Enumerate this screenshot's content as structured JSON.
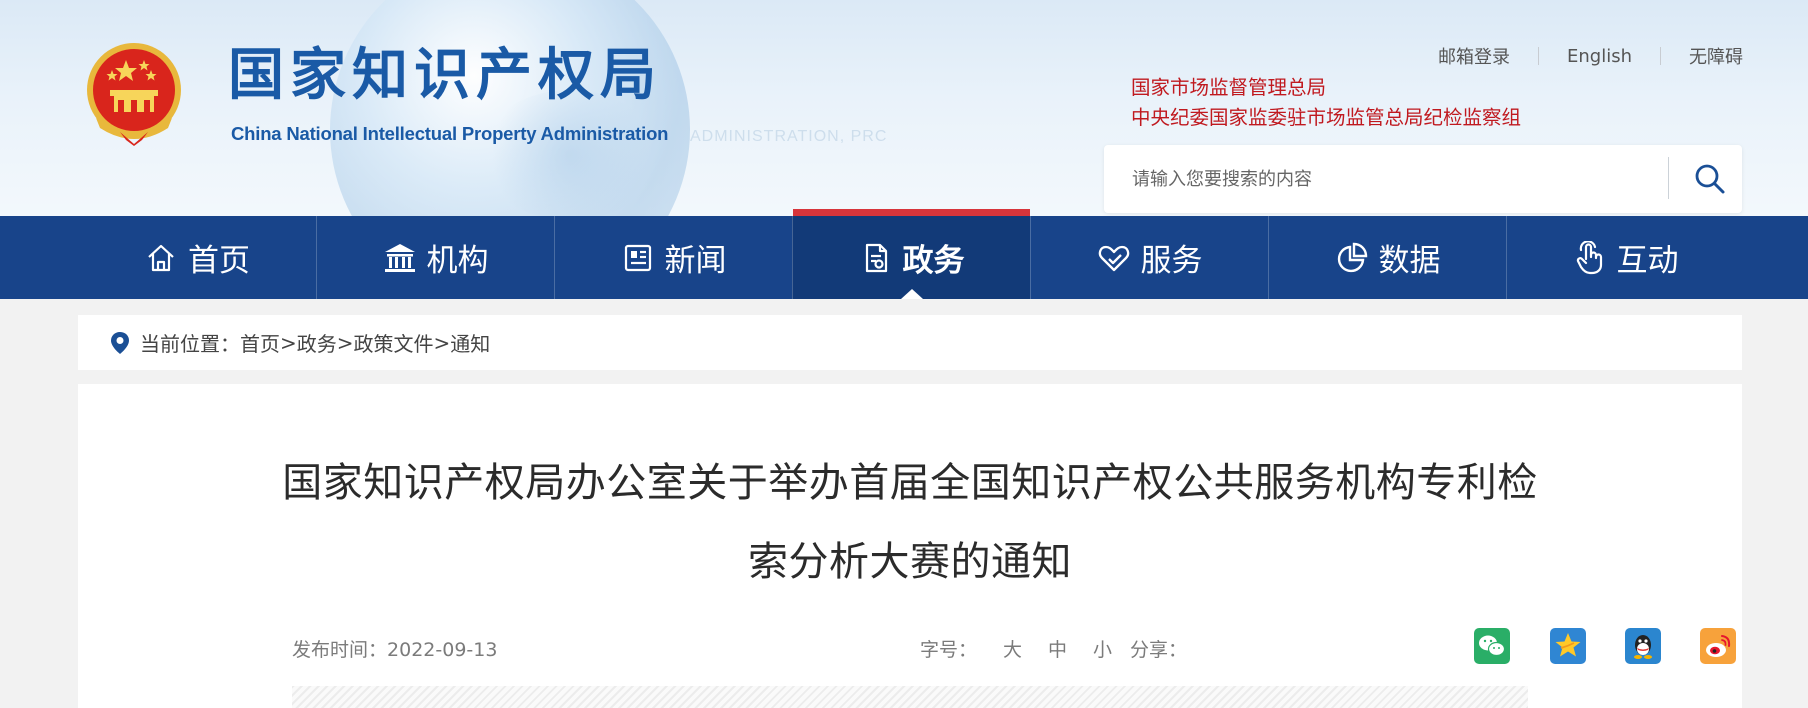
{
  "header": {
    "title_cn": "国家知识产权局",
    "title_en": "China National Intellectual Property Administration",
    "watermark": "ADMINISTRATION, PRC",
    "top_links": [
      "邮箱登录",
      "English",
      "无障碍"
    ],
    "org_links": [
      "国家市场监督管理总局",
      "中央纪委国家监委驻市场监管总局纪检监察组"
    ],
    "search": {
      "placeholder": "请输入您要搜索的内容",
      "value": ""
    }
  },
  "nav": {
    "items": [
      {
        "label": "首页",
        "icon": "home-icon"
      },
      {
        "label": "机构",
        "icon": "institution-icon"
      },
      {
        "label": "新闻",
        "icon": "news-icon"
      },
      {
        "label": "政务",
        "icon": "document-icon",
        "active": true
      },
      {
        "label": "服务",
        "icon": "service-heart-icon"
      },
      {
        "label": "数据",
        "icon": "pie-chart-icon"
      },
      {
        "label": "互动",
        "icon": "hand-pointer-icon"
      }
    ]
  },
  "breadcrumb": {
    "prefix": "当前位置：",
    "items": [
      "首页",
      "政务",
      "政策文件",
      "通知"
    ],
    "separator": ">"
  },
  "article": {
    "title_line1": "国家知识产权局办公室关于举办首届全国知识产权公共服务机构专利检",
    "title_line2": "索分析大赛的通知",
    "publish_label": "发布时间：",
    "publish_date": "2022-09-13",
    "fontsize_label": "字号：",
    "fontsize_options": [
      "大",
      "中",
      "小"
    ],
    "share_label": "分享：",
    "share_icons": [
      "wechat-icon",
      "qzone-icon",
      "qq-icon",
      "weibo-icon"
    ]
  },
  "colors": {
    "nav_bg": "#18448a",
    "nav_active": "#123a78",
    "accent_red": "#c0191f",
    "title_blue": "#1a5aa6"
  }
}
